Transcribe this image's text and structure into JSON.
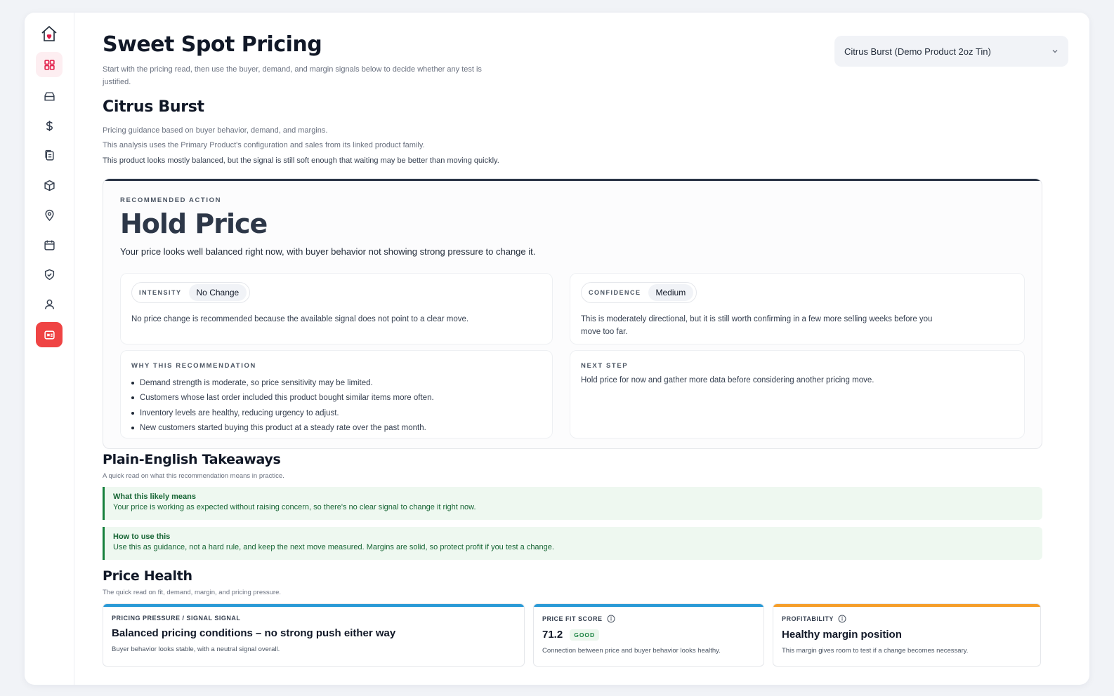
{
  "sidebar": {
    "icons": [
      "home-heart-icon",
      "grid-icon",
      "box-icon",
      "dollar-icon",
      "copy-icon",
      "cube-icon",
      "map-pin-icon",
      "calendar-icon",
      "shield-check-icon",
      "user-icon",
      "pricing-icon"
    ],
    "accent": "#ef4444"
  },
  "header": {
    "title": "Sweet Spot Pricing",
    "subtitle": "Start with the pricing read, then use the buyer, demand, and margin signals below to decide whether any test is justified."
  },
  "product_select": {
    "value": "Citrus Burst (Demo Product 2oz Tin)"
  },
  "product": {
    "name": "Citrus Burst",
    "line1": "Pricing guidance based on buyer behavior, demand, and margins.",
    "line2": "This analysis uses the Primary Product's configuration and sales from its linked product family.",
    "line3": "This product looks mostly balanced, but the signal is still soft enough that waiting may be better than moving quickly."
  },
  "recommendation": {
    "kicker": "RECOMMENDED ACTION",
    "action": "Hold Price",
    "description": "Your price looks well balanced right now, with buyer behavior not showing strong pressure to change it.",
    "intensity": {
      "label": "INTENSITY",
      "value": "No Change",
      "text": "No price change is recommended because the available signal does not point to a clear move."
    },
    "confidence": {
      "label": "CONFIDENCE",
      "value": "Medium",
      "text": "This is moderately directional, but it is still worth confirming in a few more selling weeks before you move too far."
    },
    "why": {
      "label": "WHY THIS RECOMMENDATION",
      "items": [
        "Demand strength is moderate, so price sensitivity may be limited.",
        "Customers whose last order included this product bought similar items more often.",
        "Inventory levels are healthy, reducing urgency to adjust.",
        "New customers started buying this product at a steady rate over the past month."
      ]
    },
    "next_step": {
      "label": "NEXT STEP",
      "text": "Hold price for now and gather more data before considering another pricing move."
    }
  },
  "takeaways": {
    "title": "Plain-English Takeaways",
    "subtitle": "A quick read on what this recommendation means in practice.",
    "items": [
      {
        "title": "What this likely means",
        "text": "Your price is working as expected without raising concern, so there's no clear signal to change it right now."
      },
      {
        "title": "How to use this",
        "text": "Use this as guidance, not a hard rule, and keep the next move measured. Margins are solid, so protect profit if you test a change."
      }
    ]
  },
  "price_health": {
    "title": "Price Health",
    "subtitle": "The quick read on fit, demand, margin, and pricing pressure.",
    "cards": [
      {
        "label": "PRICING PRESSURE / SIGNAL SIGNAL",
        "value": "Balanced pricing conditions – no strong push either way",
        "note": "Buyer behavior looks stable, with a neutral signal overall.",
        "color": "#2a9ad6"
      },
      {
        "label": "PRICE FIT SCORE",
        "value": "71.2",
        "badge": "GOOD",
        "note": "Connection between price and buyer behavior looks healthy.",
        "color": "#2a9ad6"
      },
      {
        "label": "PROFITABILITY",
        "value": "Healthy margin position",
        "note": "This margin gives room to test if a change becomes necessary.",
        "color": "#f59e2a"
      }
    ]
  }
}
